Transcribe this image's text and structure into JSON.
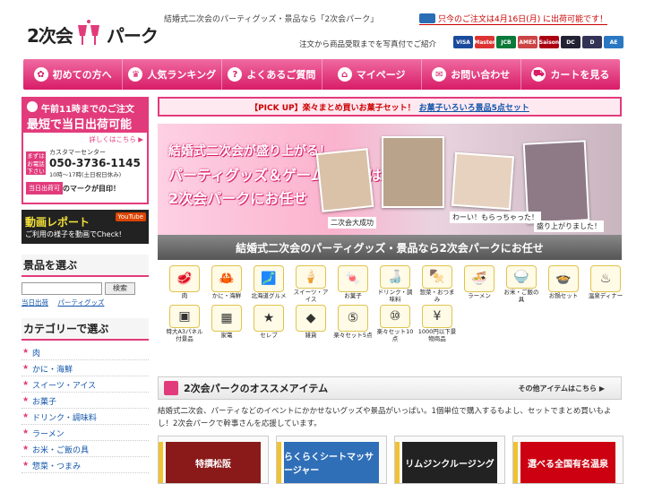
{
  "header": {
    "logo_left": "2次会",
    "logo_right": "パーク",
    "tagline": "結婚式二次会のパーティグッズ・景品なら「2次会パーク」",
    "ship_note": "只今のご注文は4月16日(月) に出荷可能です！",
    "photo_note": "注文から商品受取までを写真付でご紹介",
    "cards": [
      {
        "label": "VISA",
        "color": "#1a4a9c"
      },
      {
        "label": "Master",
        "color": "#d33"
      },
      {
        "label": "JCB",
        "color": "#0a7a3a"
      },
      {
        "label": "AMEX",
        "color": "#c44"
      },
      {
        "label": "Saison",
        "color": "#a01"
      },
      {
        "label": "DC",
        "color": "#223"
      },
      {
        "label": "D",
        "color": "#335"
      },
      {
        "label": "AE",
        "color": "#2a78c2"
      }
    ]
  },
  "nav": [
    {
      "label": "初めての方へ",
      "icon": "leaf-icon",
      "glyph": "✿"
    },
    {
      "label": "人気ランキング",
      "icon": "crown-icon",
      "glyph": "♛"
    },
    {
      "label": "よくあるご質問",
      "icon": "question-icon",
      "glyph": "?"
    },
    {
      "label": "マイページ",
      "icon": "home-icon",
      "glyph": "⌂"
    },
    {
      "label": "お問い合わせ",
      "icon": "mail-icon",
      "glyph": "✉"
    },
    {
      "label": "カートを見る",
      "icon": "cart-icon",
      "glyph": "⛟"
    }
  ],
  "sidebar": {
    "ship_top": "午前11時までのご注文",
    "ship_big": "最短で当日出荷可能",
    "ship_detail": "詳しくはこちら ▶",
    "phone_tag": "まずはお電話下さい",
    "phone_center": "カスタマーセンター",
    "phone_number": "050-3736-1145",
    "phone_hours": "10時〜17時(土日祝日休み)",
    "mark_badge": "当日出荷可",
    "mark_text": "のマークが目印！",
    "video_title": "動画レポート",
    "video_sub": "ご利用の様子を動画でCheck!",
    "video_badge": "YouTube",
    "search_title": "景品を選ぶ",
    "search_button": "検索",
    "search_links": [
      "当日出荷",
      "パーティグッズ"
    ],
    "category_title": "カテゴリーで選ぶ",
    "categories": [
      "肉",
      "かに・海鮮",
      "スイーツ・アイス",
      "お菓子",
      "ドリンク・調味料",
      "ラーメン",
      "お米・ご飯の具",
      "惣菜・つまみ"
    ]
  },
  "main": {
    "pickup_text": "【PICK UP】楽々まとめ買いお菓子セット！",
    "pickup_link": "お菓子いろいろ景品5点セット",
    "banner_lines": [
      "結婚式二次会が盛り上がる！",
      "パーティグッズ＆ゲームの景品は",
      "2次会パークにお任せ"
    ],
    "banner_captions": [
      "二次会大成功",
      "わーい！もらっちゃった！",
      "盛り上がりました！"
    ],
    "grey_bar": "結婚式二次会のパーティグッズ・景品なら2次会パークにお任せ",
    "icons": [
      {
        "label": "肉",
        "icon": "meat-icon",
        "glyph": "🥩"
      },
      {
        "label": "かに・海鮮",
        "icon": "crab-icon",
        "glyph": "🦀"
      },
      {
        "label": "北海道グルメ",
        "icon": "hokkaido-icon",
        "glyph": "🗾"
      },
      {
        "label": "スイーツ・アイス",
        "icon": "icecream-icon",
        "glyph": "🍦"
      },
      {
        "label": "お菓子",
        "icon": "candy-icon",
        "glyph": "🍬"
      },
      {
        "label": "ドリンク・調味料",
        "icon": "drink-icon",
        "glyph": "🍶"
      },
      {
        "label": "惣菜・おつまみ",
        "icon": "snack-icon",
        "glyph": "🍢"
      },
      {
        "label": "ラーメン",
        "icon": "ramen-icon",
        "glyph": "🍜"
      },
      {
        "label": "お米・ご飯の具",
        "icon": "rice-icon",
        "glyph": "🍚"
      },
      {
        "label": "お鍋セット",
        "icon": "pot-icon",
        "glyph": "🍲"
      },
      {
        "label": "温泉ディナー",
        "icon": "onsen-icon",
        "glyph": "♨"
      },
      {
        "label": "特大A3パネル付景品",
        "icon": "panel-icon",
        "glyph": "▣"
      },
      {
        "label": "家電",
        "icon": "appliance-icon",
        "glyph": "▦"
      },
      {
        "label": "セレブ",
        "icon": "celeb-icon",
        "glyph": "★"
      },
      {
        "label": "雑貨",
        "icon": "goods-icon",
        "glyph": "◆"
      },
      {
        "label": "楽々セット5点",
        "icon": "set5-icon",
        "glyph": "⑤"
      },
      {
        "label": "楽々セット10点",
        "icon": "set10-icon",
        "glyph": "⑩"
      },
      {
        "label": "1000円以下景物商品",
        "icon": "cheap-icon",
        "glyph": "¥"
      }
    ],
    "rec_title": "2次会パークのオススメアイテム",
    "rec_more": "その他アイテムはこちら ▶",
    "rec_text": "結婚式二次会、パーティなどのイベントにかかせないグッズや景品がいっぱい。1個単位で購入するもよし、セットでまとめ買いもよし！2次会パークで幹事さんを応援しています。",
    "products": [
      {
        "label": "特撰松阪",
        "color": "#8a1a1a"
      },
      {
        "label": "らくらくシートマッサージャー",
        "color": "#2f6fb8"
      },
      {
        "label": "リムジンクルージング",
        "color": "#222"
      },
      {
        "label": "選べる全国有名温泉",
        "color": "#c01"
      }
    ]
  }
}
